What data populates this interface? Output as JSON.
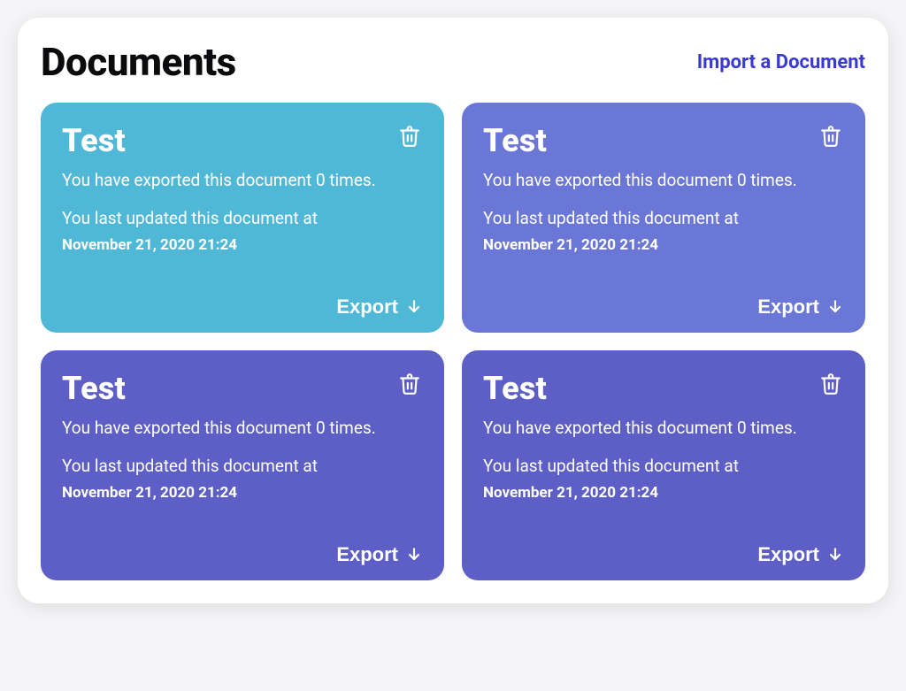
{
  "header": {
    "title": "Documents",
    "import_label": "Import a Document"
  },
  "colors": {
    "card_bg_0": "#4fb8d6",
    "card_bg_1": "#6a77d6",
    "card_bg_2": "#5d5fc7",
    "card_bg_3": "#5d5fc7",
    "import_link": "#3a3ad1"
  },
  "labels": {
    "export": "Export"
  },
  "cards": [
    {
      "title": "Test",
      "exported_line": "You have exported this document 0 times.",
      "updated_line": "You last updated this document at",
      "timestamp": "November 21, 2020 21:24"
    },
    {
      "title": "Test",
      "exported_line": "You have exported this document 0 times.",
      "updated_line": "You last updated this document at",
      "timestamp": "November 21, 2020 21:24"
    },
    {
      "title": "Test",
      "exported_line": "You have exported this document 0 times.",
      "updated_line": "You last updated this document at",
      "timestamp": "November 21, 2020 21:24"
    },
    {
      "title": "Test",
      "exported_line": "You have exported this document 0 times.",
      "updated_line": "You last updated this document at",
      "timestamp": "November 21, 2020 21:24"
    }
  ]
}
